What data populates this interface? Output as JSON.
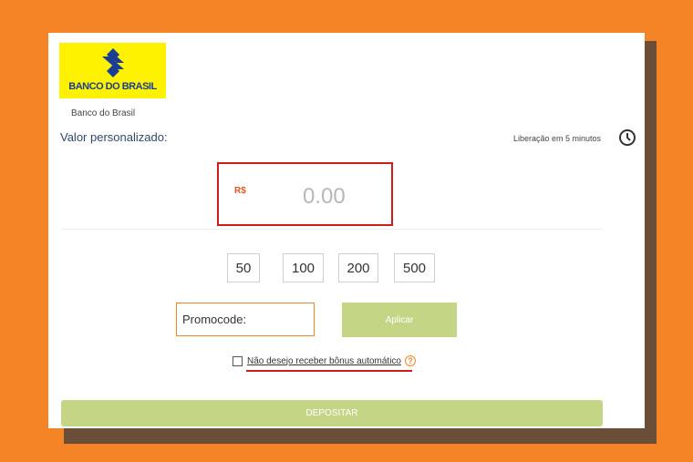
{
  "bank": {
    "logo_text": "BANCO DO BRASIL",
    "name": "Banco do Brasil"
  },
  "section": {
    "title": "Valor personalizado:",
    "release_text": "Liberação em 5 minutos"
  },
  "amount": {
    "currency": "R$",
    "value": "0.00"
  },
  "presets": [
    "50",
    "100",
    "200",
    "500"
  ],
  "promo": {
    "placeholder": "Promocode:",
    "apply_label": "Aplicar"
  },
  "bonus": {
    "label": "Não desejo receber bônus automático",
    "help": "?"
  },
  "deposit_label": "DEPOSITAR",
  "colors": {
    "background": "#f58426",
    "accent_button": "#c4d686",
    "highlight_red": "#d11c1c",
    "logo_yellow": "#fff200",
    "logo_blue": "#1a3e93"
  }
}
